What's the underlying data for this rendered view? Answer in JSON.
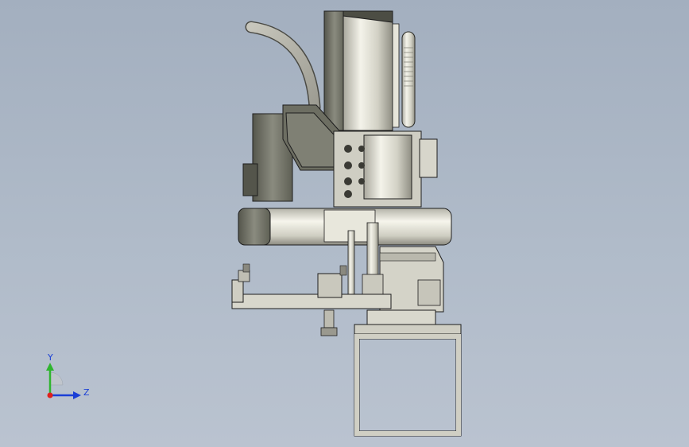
{
  "viewport": {
    "background_top": "#a3afbf",
    "background_bottom": "#bac3d0"
  },
  "triad": {
    "y_label": "Y",
    "z_label": "Z",
    "y_color": "#2fb52f",
    "z_color": "#1a3fd6",
    "origin_color": "#e0201c"
  },
  "model": {
    "body_color": "#d9d8cc",
    "dark_color": "#6f7064",
    "edge_color": "#1e1e1e"
  }
}
